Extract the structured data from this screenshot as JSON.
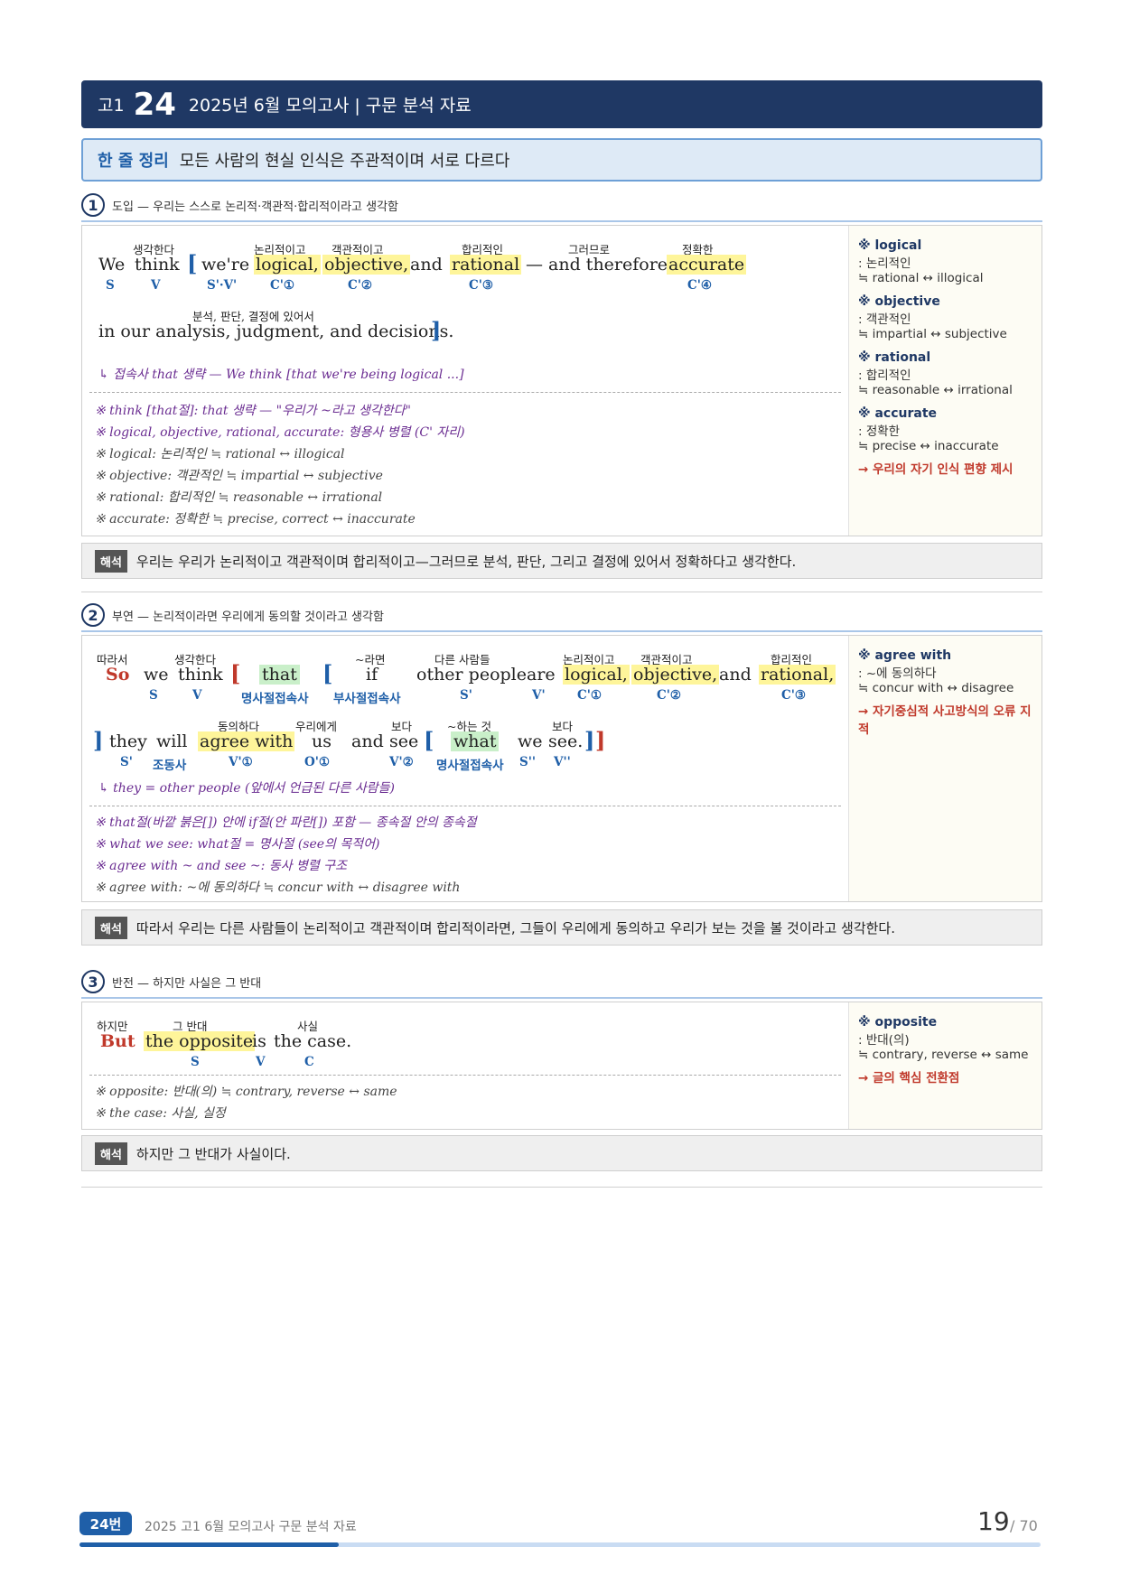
{
  "header": {
    "grade": "고1",
    "number": "24",
    "title": "2025년 6월 모의고사 | 구문 분석 자료"
  },
  "summary": {
    "label": "한 줄 정리",
    "text": "모든 사람의 현실 인식은 주관적이며 서로 다르다"
  },
  "s1": {
    "num": "1",
    "title": "도입 — 우리는 스스로 논리적·객관적·합리적이라고 생각함",
    "gloss": {
      "think": "생각한다",
      "logical": "논리적이고",
      "objective": "객관적이고",
      "rational": "합리적인",
      "therefore": "그러므로",
      "accurate": "정확한",
      "in": "분석, 판단, 결정에 있어서"
    },
    "words": {
      "we": "We",
      "think": "think",
      "open": "[",
      "were": "we're",
      "logical": "logical,",
      "objective": "objective,",
      "and": "and",
      "rational": "rational",
      "therefore": "— and therefore",
      "accurate": "accurate",
      "line2": "in our analysis, judgment, and decisions.",
      "close": "]"
    },
    "tags": {
      "s": "S",
      "v": "V",
      "sv": "S'·V'",
      "c1": "C'①",
      "c2": "C'②",
      "c3": "C'③",
      "c4": "C'④"
    },
    "note": "↳ 접속사 that 생략 — We think [that we're being logical ...]",
    "notes": [
      "※ think [that절]: that 생략 — \"우리가 ~라고 생각한다\"",
      "※ logical, objective, rational, accurate: 형용사 병렬 (C' 자리)",
      "※ logical: 논리적인 ≒ rational ↔ illogical",
      "※ objective: 객관적인 ≒ impartial ↔ subjective",
      "※ rational: 합리적인 ≒ reasonable ↔ irrational",
      "※ accurate: 정확한 ≒ precise, correct ↔ inaccurate"
    ],
    "side": [
      {
        "term": "※ logical",
        "def": ": 논리적인",
        "syn": "≒ rational ↔ illogical"
      },
      {
        "term": "※ objective",
        "def": ": 객관적인",
        "syn": "≒ impartial ↔ subjective"
      },
      {
        "term": "※ rational",
        "def": ": 합리적인",
        "syn": "≒ reasonable ↔ irrational"
      },
      {
        "term": "※ accurate",
        "def": ": 정확한",
        "syn": "≒ precise ↔ inaccurate"
      }
    ],
    "arrow": "→ 우리의 자기 인식 편향 제시",
    "trans_label": "해석",
    "trans": "우리는 우리가 논리적이고 객관적이며 합리적이고—그러므로 분석, 판단, 그리고 결정에 있어서 정확하다고 생각한다."
  },
  "s2": {
    "num": "2",
    "title": "부연 — 논리적이라면 우리에게 동의할 것이라고 생각함",
    "gloss": {
      "so": "따라서",
      "think": "생각한다",
      "if": "~라면",
      "people": "다른 사람들",
      "logical": "논리적이고",
      "objective": "객관적이고",
      "rational": "합리적인",
      "agree": "동의하다",
      "us": "우리에게",
      "see": "보다",
      "what": "~하는 것",
      "see2": "보다"
    },
    "words": {
      "so": "So",
      "we": "we",
      "think": "think",
      "open1": "[",
      "that": "that",
      "open2": "[",
      "if": "if",
      "people": "other people",
      "are": "are",
      "logical": "logical,",
      "objective": "objective,",
      "and": "and",
      "rational": "rational,",
      "close2": "]",
      "they": "they",
      "will": "will",
      "agree": "agree with",
      "us": "us",
      "and2": "and",
      "see": "see",
      "open3": "[",
      "what": "what",
      "we2": "we",
      "see2": "see.",
      "close3": "]",
      "close1": "]"
    },
    "tags": {
      "s": "S",
      "v": "V",
      "that": "명사절접속사",
      "if": "부사절접속사",
      "s1": "S'",
      "v1": "V'",
      "c1": "C'①",
      "c2": "C'②",
      "c3": "C'③",
      "s2": "S'",
      "aux": "조동사",
      "v2": "V'①",
      "o": "O'①",
      "v3": "V'②",
      "what": "명사절접속사",
      "s3": "S''",
      "v4": "V''"
    },
    "note": "↳ they = other people (앞에서 언급된 다른 사람들)",
    "notes": [
      "※ that절(바깥 붉은[]) 안에 if절(안 파란[]) 포함 — 종속절 안의 종속절",
      "※ what we see: what절 = 명사절 (see의 목적어)",
      "※ agree with ~ and see ~: 동사 병렬 구조",
      "※ agree with: ~에 동의하다 ≒ concur with ↔ disagree with"
    ],
    "side": [
      {
        "term": "※ agree with",
        "def": ": ~에 동의하다",
        "syn": "≒ concur with ↔ disagree"
      }
    ],
    "arrow": "→ 자기중심적 사고방식의 오류 지적",
    "trans_label": "해석",
    "trans": "따라서 우리는 다른 사람들이 논리적이고 객관적이며 합리적이라면, 그들이 우리에게 동의하고 우리가 보는 것을 볼 것이라고 생각한다."
  },
  "s3": {
    "num": "3",
    "title": "반전 — 하지만 사실은 그 반대",
    "gloss": {
      "but": "하지만",
      "opposite": "그 반대",
      "case": "사실"
    },
    "words": {
      "but": "But",
      "opposite": "the opposite",
      "is": "is",
      "case": "the case."
    },
    "tags": {
      "s": "S",
      "v": "V",
      "c": "C"
    },
    "notes": [
      "※ opposite: 반대(의) ≒ contrary, reverse ↔ same",
      "※ the case: 사실, 실정"
    ],
    "side": [
      {
        "term": "※ opposite",
        "def": ": 반대(의)",
        "syn": "≒ contrary, reverse ↔ same"
      }
    ],
    "arrow": "→ 글의 핵심 전환점",
    "trans_label": "해석",
    "trans": "하지만 그 반대가 사실이다."
  },
  "footer": {
    "badge": "24번",
    "text": "2025 고1 6월 모의고사 구문 분석 자료",
    "page": "19",
    "total": "/ 70",
    "progress": 0.27
  }
}
